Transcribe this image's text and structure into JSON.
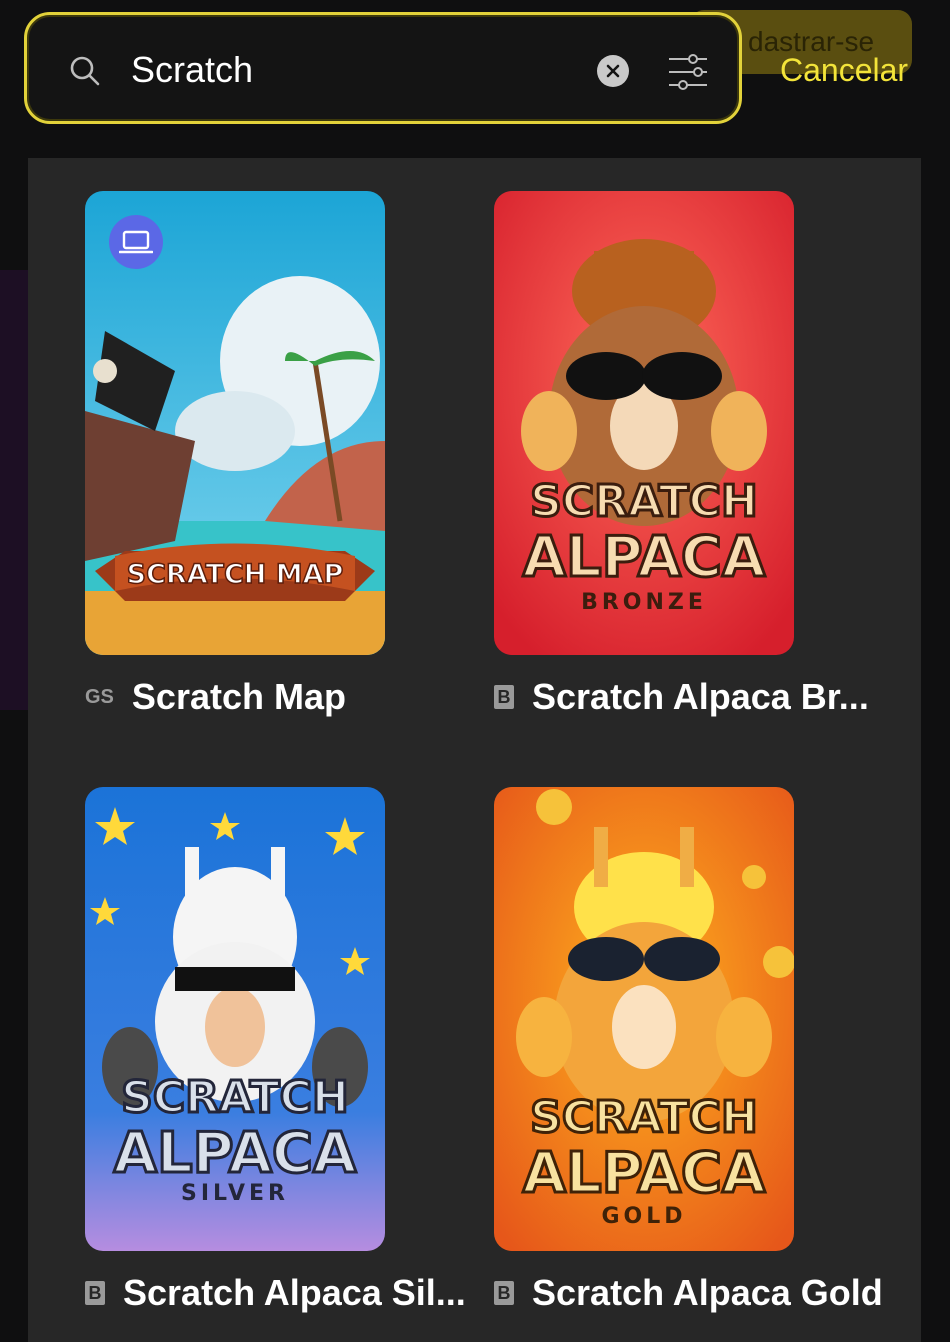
{
  "header": {
    "background_register_label": "dastrar-se",
    "cancel_label": "Cancelar"
  },
  "search": {
    "value": "Scratch",
    "placeholder": ""
  },
  "icons": {
    "search": "search-icon",
    "clear": "close-circle-icon",
    "filter": "sliders-icon",
    "device": "laptop-icon"
  },
  "colors": {
    "accent": "#f3e43a",
    "panel": "#272727",
    "badge": "#5b68e6"
  },
  "results": [
    {
      "title": "Scratch Map",
      "provider": "GS",
      "art_text": [
        "SCRATCH MAP"
      ]
    },
    {
      "title": "Scratch Alpaca Br...",
      "provider": "B",
      "art_text": [
        "SCRATCH",
        "ALPACA",
        "BRONZE"
      ]
    },
    {
      "title": "Scratch Alpaca Sil...",
      "provider": "B",
      "art_text": [
        "SCRATCH",
        "ALPACA",
        "SILVER"
      ]
    },
    {
      "title": "Scratch Alpaca Gold",
      "provider": "B",
      "art_text": [
        "SCRATCH",
        "ALPACA",
        "GOLD"
      ]
    }
  ]
}
